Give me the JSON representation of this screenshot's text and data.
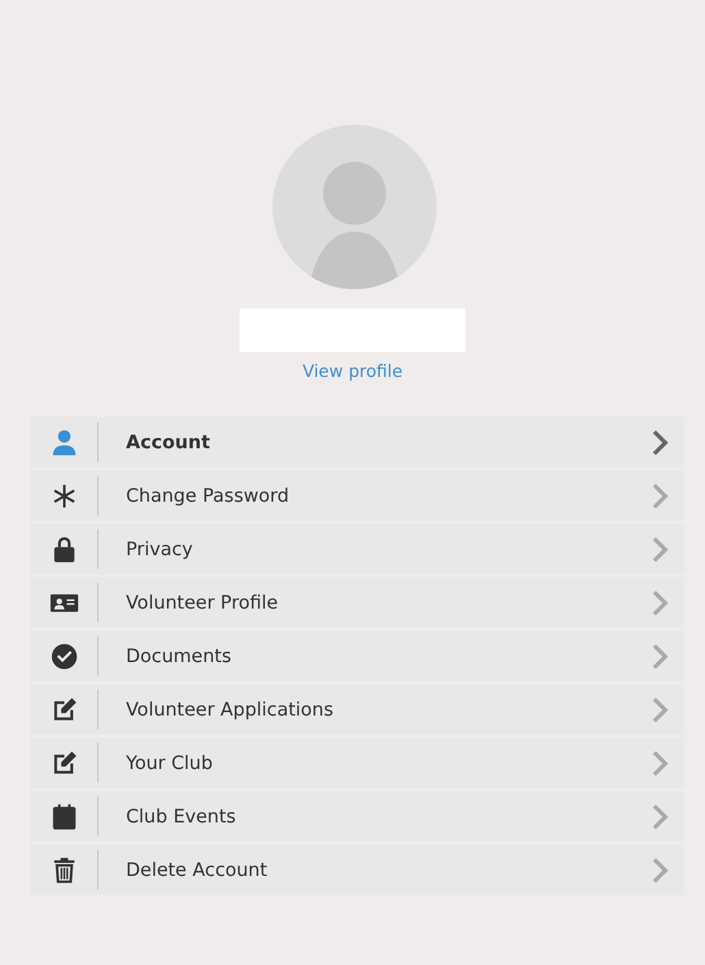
{
  "profile": {
    "link": "View profile"
  },
  "menu": [
    {
      "label": "Account",
      "selected": true
    },
    {
      "label": "Change Password",
      "selected": false
    },
    {
      "label": "Privacy",
      "selected": false
    },
    {
      "label": "Volunteer Profile",
      "selected": false
    },
    {
      "label": "Documents",
      "selected": false
    },
    {
      "label": "Volunteer Applications",
      "selected": false
    },
    {
      "label": "Your Club",
      "selected": false
    },
    {
      "label": "Club Events",
      "selected": false
    },
    {
      "label": "Delete Account",
      "selected": false
    }
  ]
}
